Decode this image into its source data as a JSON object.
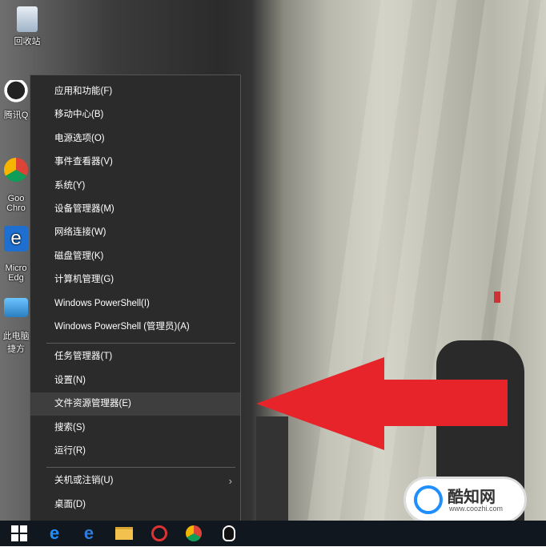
{
  "desktop": {
    "icons": [
      {
        "label": "回收站",
        "icon": "recycle-bin-icon"
      },
      {
        "label": "腾讯Q",
        "icon": "qq-icon"
      },
      {
        "label": "Goo\nChro",
        "icon": "chrome-icon"
      },
      {
        "label": "Micro\nEdg",
        "icon": "edge-icon"
      },
      {
        "label": "此电脑\n捷方",
        "icon": "this-pc-icon"
      }
    ]
  },
  "menu": {
    "items": [
      {
        "label": "应用和功能(F)"
      },
      {
        "label": "移动中心(B)"
      },
      {
        "label": "电源选项(O)"
      },
      {
        "label": "事件查看器(V)"
      },
      {
        "label": "系统(Y)"
      },
      {
        "label": "设备管理器(M)"
      },
      {
        "label": "网络连接(W)"
      },
      {
        "label": "磁盘管理(K)"
      },
      {
        "label": "计算机管理(G)"
      },
      {
        "label": "Windows PowerShell(I)"
      },
      {
        "label": "Windows PowerShell (管理员)(A)"
      },
      {
        "label": "任务管理器(T)"
      },
      {
        "label": "设置(N)"
      },
      {
        "label": "文件资源管理器(E)",
        "highlighted": true
      },
      {
        "label": "搜索(S)"
      },
      {
        "label": "运行(R)"
      },
      {
        "label": "关机或注销(U)",
        "submenu": true
      },
      {
        "label": "桌面(D)"
      }
    ]
  },
  "annotation": {
    "arrow_color": "#e8242b",
    "arrow_icon": "red-arrow-left-icon"
  },
  "taskbar": {
    "items": [
      "windows-start-icon",
      "ie-icon",
      "edge-icon",
      "file-explorer-icon",
      "snipping-icon",
      "chrome-icon",
      "qq-icon"
    ]
  },
  "watermark": {
    "brand": "酷知网",
    "url": "www.coozhi.com"
  },
  "colors": {
    "menu_bg": "#2b2b2b",
    "menu_highlight": "#3e3e3e",
    "taskbar_bg": "#10171e",
    "accent_blue": "#1f8fff"
  }
}
